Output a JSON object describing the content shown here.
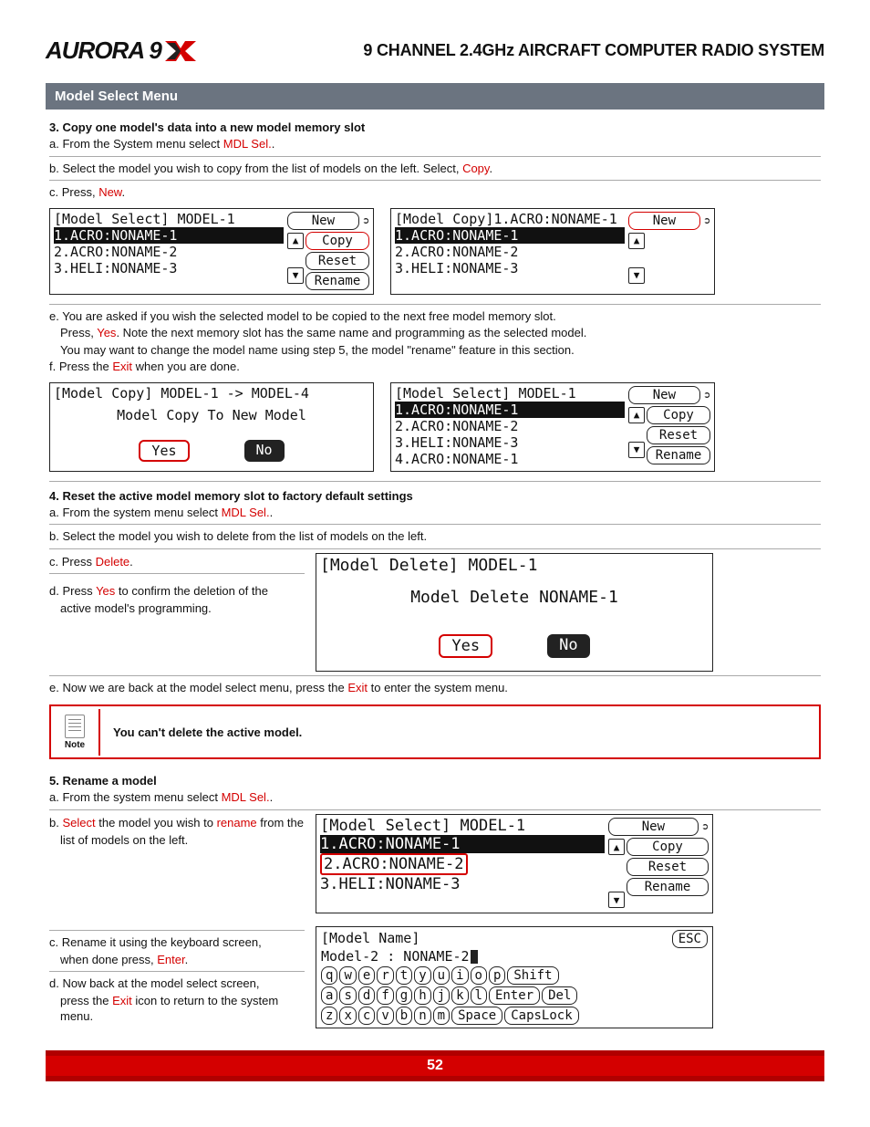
{
  "header": {
    "logo": "AURORA 9",
    "title": "9 CHANNEL 2.4GHz AIRCRAFT COMPUTER RADIO SYSTEM"
  },
  "sectionBar": "Model Select Menu",
  "s3": {
    "title": "3. Copy one model's data into a new model memory slot",
    "a1": "a. From the System menu select ",
    "a2": "MDL Sel.",
    "a3": ".",
    "b": "b. Select the model you wish to copy from the list of models on the left. Select, ",
    "b2": "Copy",
    "b3": ".",
    "c1": "c. Press, ",
    "c2": "New",
    "c3": "."
  },
  "scr1L": {
    "head": "[Model Select] MODEL-1",
    "r1": "1.ACRO:NONAME-1",
    "r2": "2.ACRO:NONAME-2",
    "r3": "3.HELI:NONAME-3",
    "btnNew": "New",
    "btnCopy": "Copy",
    "btnReset": "Reset",
    "btnRename": "Rename"
  },
  "scr1R": {
    "head": "[Model Copy]1.ACRO:NONAME-1",
    "r1": "1.ACRO:NONAME-1",
    "r2": "2.ACRO:NONAME-2",
    "r3": "3.HELI:NONAME-3",
    "btnNew": "New"
  },
  "s3e": {
    "e1": "e. You are asked if you wish the selected model to be copied to the next free model memory slot.",
    "e2a": "Press, ",
    "e2b": "Yes",
    "e2c": ". Note the next memory slot has the same name and programming as the selected model.",
    "e3": "You may want to change the model name using step 5, the model \"rename\" feature in this section.",
    "f1": "f. Press the ",
    "f2": "Exit",
    "f3": " when you are done."
  },
  "scr2L": {
    "head": "[Model Copy] MODEL-1 -> MODEL-4",
    "line": "Model Copy To New Model",
    "yes": "Yes",
    "no": "No"
  },
  "scr2R": {
    "head": "[Model Select] MODEL-1",
    "r1": "1.ACRO:NONAME-1",
    "r2": "2.ACRO:NONAME-2",
    "r3": "3.HELI:NONAME-3",
    "r4": "4.ACRO:NONAME-1",
    "btnNew": "New",
    "btnCopy": "Copy",
    "btnReset": "Reset",
    "btnRename": "Rename"
  },
  "s4": {
    "title": "4. Reset the active model memory slot to factory default settings",
    "a1": "a. From the system menu select ",
    "a2": "MDL Sel.",
    "a3": ".",
    "b": "b. Select the model you wish to delete from the list of models on the left.",
    "c1": "c. Press ",
    "c2": "Delete",
    "c3": ".",
    "d1": "d. Press ",
    "d2": "Yes",
    "d3": " to confirm the deletion of the",
    "d4": "active model's programming.",
    "e1": "e. Now we are back at the model select menu, press the ",
    "e2": "Exit",
    "e3": " to enter the system menu."
  },
  "scrDel": {
    "head": "[Model Delete] MODEL-1",
    "line": "Model Delete NONAME-1",
    "yes": "Yes",
    "no": "No"
  },
  "note": {
    "label": "Note",
    "text": "You can't delete the active model."
  },
  "s5": {
    "title": "5. Rename a model",
    "a1": "a. From the system menu select ",
    "a2": "MDL Sel.",
    "a3": ".",
    "b1": "b. ",
    "b2": "Select",
    "b3": " the model you wish to ",
    "b4": "rename",
    "b5": " from the",
    "b6": "list of models on the left.",
    "c1": "c. Rename it using the keyboard screen,",
    "c2a": "when done press, ",
    "c2b": "Enter",
    "c2c": ".",
    "d1": "d. Now back at the model select screen,",
    "d2a": "press the ",
    "d2b": "Exit",
    "d2c": " icon to return to the system menu."
  },
  "scr5": {
    "head": "[Model Select] MODEL-1",
    "r1": "1.ACRO:NONAME-1",
    "r2": "2.ACRO:NONAME-2",
    "r3": "3.HELI:NONAME-3",
    "btnNew": "New",
    "btnCopy": "Copy",
    "btnReset": "Reset",
    "btnRename": "Rename"
  },
  "kbd": {
    "head": "[Model Name]",
    "esc": "ESC",
    "line": "Model-2 : NONAME-2",
    "row1": [
      "q",
      "w",
      "e",
      "r",
      "t",
      "y",
      "u",
      "i",
      "o",
      "p"
    ],
    "row1w": "Shift",
    "row2": [
      "a",
      "s",
      "d",
      "f",
      "g",
      "h",
      "j",
      "k",
      "l"
    ],
    "row2w1": "Enter",
    "row2w2": "Del",
    "row3": [
      "z",
      "x",
      "c",
      "v",
      "b",
      "n",
      "m"
    ],
    "row3w1": "Space",
    "row3w2": "CapsLock"
  },
  "page": "52"
}
